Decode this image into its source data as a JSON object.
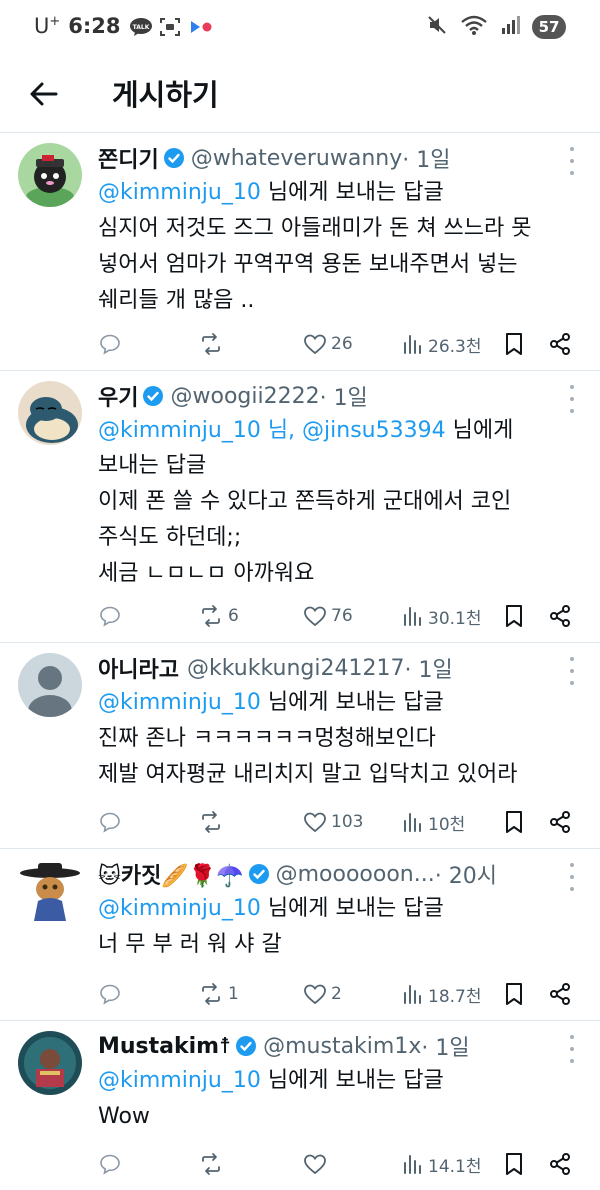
{
  "status_bar": {
    "carrier": "U",
    "carrier_sup": "+",
    "time": "6:28",
    "talk_icon_label": "TALK",
    "battery": "57"
  },
  "header": {
    "title": "게시하기"
  },
  "tweets": [
    {
      "name": "쫀디기",
      "verified": true,
      "handle": "@whateveruwanny",
      "time": "· 1일",
      "reply_prefix": "",
      "reply_mentions": "@kimminju_10",
      "reply_suffix": " 님에게 보내는 답글",
      "text": "심지어 저것도 즈그 아들래미가 돈 쳐 쓰느라 못\n넣어서 엄마가 꾸역꾸역 용돈 보내주면서 넣는\n쉐리들 개 많음 ..",
      "replies": "",
      "retweets": "",
      "likes": "26",
      "views": "26.3천"
    },
    {
      "name": "우기",
      "verified": true,
      "handle": "@woogii2222",
      "time": "· 1일",
      "reply_mentions": "@kimminju_10 님, @jinsu53394",
      "reply_suffix": " 님에게\n보내는 답글",
      "text": "이제 폰 쓸 수 있다고 쫀득하게 군대에서 코인\n주식도 하던데;;\n세금 ㄴㅁㄴㅁ 아까워요",
      "replies": "",
      "retweets": "6",
      "likes": "76",
      "views": "30.1천"
    },
    {
      "name": "아니라고",
      "verified": false,
      "handle": "@kkukkungi241217",
      "time": "· 1일",
      "reply_mentions": "@kimminju_10",
      "reply_suffix": " 님에게 보내는 답글",
      "text": "진짜 존나 ㅋㅋㅋㅋㅋㅋ멍청해보인다\n제발 여자평균 내리치지 말고 입닥치고 있어라",
      "replies": "",
      "retweets": "",
      "likes": "103",
      "views": "10천"
    },
    {
      "name": "🐱카짓🥖🌹☂️",
      "verified": true,
      "handle": "@moooooon...",
      "time": " · 20시",
      "reply_mentions": "@kimminju_10",
      "reply_suffix": " 님에게 보내는 답글",
      "text": "너 무 부 러 워 샤 갈",
      "replies": "",
      "retweets": "1",
      "likes": "2",
      "views": "18.7천"
    },
    {
      "name": "Mustakim☨",
      "verified": true,
      "handle": "@mustakim1x",
      "time": "· 1일",
      "reply_mentions": "@kimminju_10",
      "reply_suffix": " 님에게 보내는 답글",
      "text": "Wow",
      "replies": "",
      "retweets": "",
      "likes": "",
      "views": "14.1천"
    }
  ],
  "colors": {
    "link": "#1d9bf0",
    "secondary_text": "#536471",
    "divider": "#e1e8ed",
    "verified": "#1d9bf0"
  }
}
